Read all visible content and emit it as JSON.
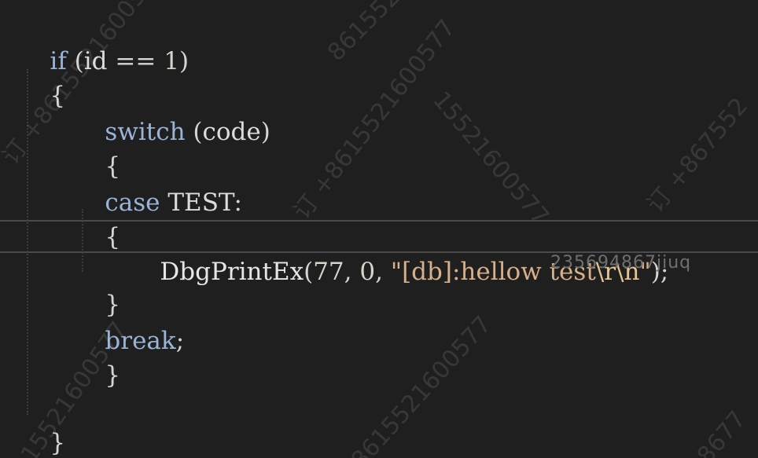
{
  "code": {
    "lines": [
      {
        "if_kw": "if",
        "open": " (",
        "ident": "id",
        "op": " == ",
        "num": "1",
        "close": ")"
      },
      {
        "text": "{"
      },
      {
        "switch_kw": "switch",
        "open": " (",
        "ident": "code",
        "close": ")"
      },
      {
        "text": "{"
      },
      {
        "case_kw": "case",
        "ident": " TEST",
        "colon": ":"
      },
      {
        "text": "{"
      },
      {
        "fn": "DbgPrintEx",
        "open": "(",
        "arg1": "77",
        "sep1": ", ",
        "arg2": "0",
        "sep2": ", ",
        "str": "\"[db]:hellow test",
        "esc": "\\r\\n",
        "str_end": "\"",
        "close": ");"
      },
      {
        "text": "}"
      },
      {
        "break_kw": "break",
        "semi": ";"
      },
      {
        "text": "}"
      },
      {
        "text": "}"
      }
    ]
  },
  "hint_text": "235694867jiuq",
  "watermarks": [
    "订 +8615521600577",
    "8615521600577",
    "订 +8615521600577",
    "订 +867552",
    "15521600577",
    "8615521600577",
    "15521600577",
    "8677"
  ],
  "colors": {
    "background": "#1f1f1f",
    "keyword": "#9ab3d6",
    "string": "#d7b08a",
    "text": "#d4d4d4"
  }
}
